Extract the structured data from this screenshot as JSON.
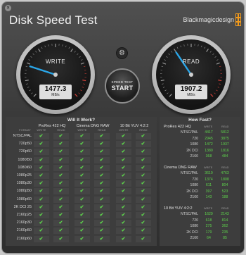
{
  "app": {
    "title": "Disk Speed Test",
    "brand": "Blackmagicdesign",
    "close_glyph": "×",
    "accent_color": "#f29a1b",
    "check_color": "#5dd24b"
  },
  "gauges": {
    "write": {
      "label": "WRITE",
      "value": "1477.3",
      "unit": "MB/s"
    },
    "read": {
      "label": "READ",
      "value": "1907.2",
      "unit": "MB/s"
    }
  },
  "controls": {
    "settings_icon": "gear-icon",
    "start_line1": "SPEED TEST",
    "start_line2": "START"
  },
  "will_it_work": {
    "title": "Will It Work?",
    "format_label": "FORMAT",
    "groups": [
      {
        "name": "ProRes 422 HQ",
        "write": "WRITE",
        "read": "READ"
      },
      {
        "name": "Cinema DNG RAW",
        "write": "WRITE",
        "read": "READ"
      },
      {
        "name": "10 Bit YUV 4:2:2",
        "write": "WRITE",
        "read": "READ"
      }
    ],
    "check_glyph": "✔",
    "formats": [
      "NTSC/PAL",
      "720p50",
      "720p60",
      "1080i50",
      "1080i60",
      "1080p25",
      "1080p30",
      "1080p50",
      "1080p60",
      "2K DCI 25",
      "2160p25",
      "2160p30",
      "2160p50",
      "2160p60"
    ]
  },
  "how_fast": {
    "title": "How Fast?",
    "sections": [
      {
        "name": "ProRes 422 HQ",
        "write": "WRITE",
        "read": "READ",
        "rows": [
          {
            "res": "NTSC/PAL",
            "w": "4417",
            "r": "5812"
          },
          {
            "res": "720",
            "w": "2945",
            "r": "3875"
          },
          {
            "res": "1080",
            "w": "1472",
            "r": "1937"
          },
          {
            "res": "2K DCI",
            "w": "1380",
            "r": "1816"
          },
          {
            "res": "2160",
            "w": "368",
            "r": "484"
          }
        ]
      },
      {
        "name": "Cinema DNG RAW",
        "write": "WRITE",
        "read": "READ",
        "rows": [
          {
            "res": "NTSC/PAL",
            "w": "3619",
            "r": "4763"
          },
          {
            "res": "720",
            "w": "1374",
            "r": "1808"
          },
          {
            "res": "1080",
            "w": "611",
            "r": "804"
          },
          {
            "res": "2K DCI",
            "w": "397",
            "r": "523"
          },
          {
            "res": "2160",
            "w": "143",
            "r": "188"
          }
        ]
      },
      {
        "name": "10 Bit YUV 4:2:2",
        "write": "WRITE",
        "read": "READ",
        "rows": [
          {
            "res": "NTSC/PAL",
            "w": "1629",
            "r": "2143"
          },
          {
            "res": "720",
            "w": "618",
            "r": "814"
          },
          {
            "res": "1080",
            "w": "275",
            "r": "362"
          },
          {
            "res": "2K DCI",
            "w": "179",
            "r": "235"
          },
          {
            "res": "2160",
            "w": "64",
            "r": "85"
          }
        ]
      }
    ]
  }
}
